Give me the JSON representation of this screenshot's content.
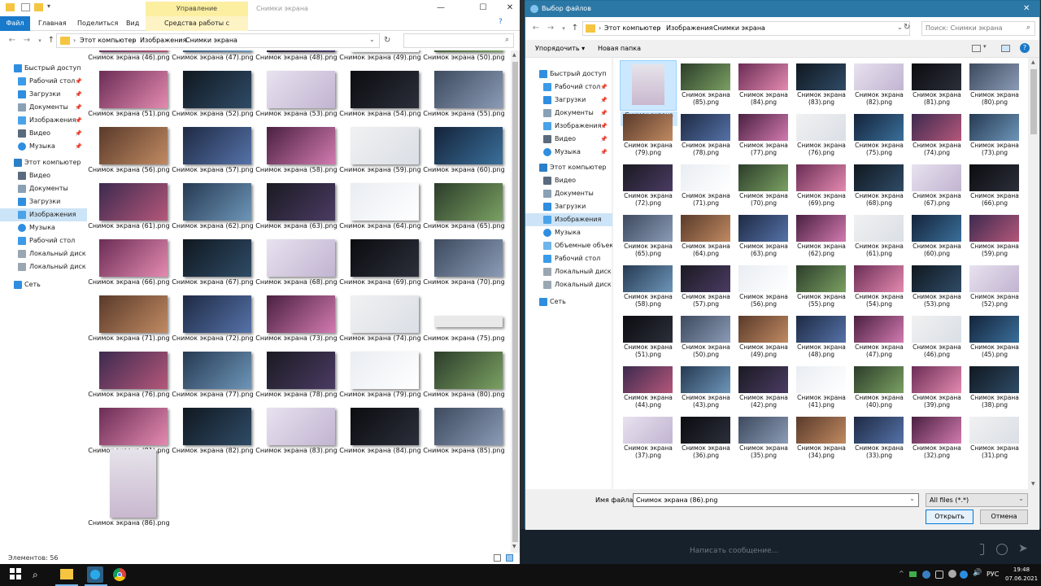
{
  "explorer": {
    "title": "Снимки экрана",
    "tabs": {
      "file": "Файл",
      "home": "Главная",
      "share": "Поделиться",
      "view": "Вид",
      "manage": "Управление",
      "context": "Средства работы с рисунками"
    },
    "breadcrumb": [
      "Этот компьютер",
      "Изображения",
      "Снимки экрана"
    ],
    "sidebar": {
      "quick": "Быстрый доступ",
      "quick_items": [
        "Рабочий стол",
        "Загрузки",
        "Документы",
        "Изображения",
        "Видео",
        "Музыка"
      ],
      "pc": "Этот компьютер",
      "pc_items": [
        "Видео",
        "Документы",
        "Загрузки",
        "Изображения",
        "Музыка",
        "Рабочий стол",
        "Локальный диск (C",
        "Локальный диск (D"
      ],
      "network": "Сеть"
    },
    "files": [
      "Снимок экрана (46).png",
      "Снимок экрана (47).png",
      "Снимок экрана (48).png",
      "Снимок экрана (49).png",
      "Снимок экрана (50).png",
      "Снимок экрана (51).png",
      "Снимок экрана (52).png",
      "Снимок экрана (53).png",
      "Снимок экрана (54).png",
      "Снимок экрана (55).png",
      "Снимок экрана (56).png",
      "Снимок экрана (57).png",
      "Снимок экрана (58).png",
      "Снимок экрана (59).png",
      "Снимок экрана (60).png",
      "Снимок экрана (61).png",
      "Снимок экрана (62).png",
      "Снимок экрана (63).png",
      "Снимок экрана (64).png",
      "Снимок экрана (65).png",
      "Снимок экрана (66).png",
      "Снимок экрана (67).png",
      "Снимок экрана (68).png",
      "Снимок экрана (69).png",
      "Снимок экрана (70).png",
      "Снимок экрана (71).png",
      "Снимок экрана (72).png",
      "Снимок экрана (73).png",
      "Снимок экрана (74).png",
      "Снимок экрана (75).png",
      "Снимок экрана (76).png",
      "Снимок экрана (77).png",
      "Снимок экрана (78).png",
      "Снимок экрана (79).png",
      "Снимок экрана (80).png",
      "Снимок экрана (81).png",
      "Снимок экрана (82).png",
      "Снимок экрана (83).png",
      "Снимок экрана (84).png",
      "Снимок экрана (85).png",
      "Снимок экрана (86).png"
    ],
    "status": "Элементов: 56"
  },
  "dialog": {
    "title": "Выбор файлов",
    "breadcrumb": [
      "Этот компьютер",
      "Изображения",
      "Снимки экрана"
    ],
    "search_placeholder": "Поиск: Снимки экрана",
    "organize": "Упорядочить",
    "new_folder": "Новая папка",
    "sidebar": {
      "quick": "Быстрый доступ",
      "quick_items": [
        "Рабочий стол",
        "Загрузки",
        "Документы",
        "Изображения",
        "Видео",
        "Музыка"
      ],
      "pc": "Этот компьютер",
      "pc_items": [
        "Видео",
        "Документы",
        "Загрузки",
        "Изображения",
        "Музыка",
        "Объемные объекты",
        "Рабочий стол",
        "Локальный диск (C",
        "Локальный диск (D"
      ],
      "network": "Сеть"
    },
    "files": [
      "Снимок экрана (86).png",
      "Снимок экрана (85).png",
      "Снимок экрана (84).png",
      "Снимок экрана (83).png",
      "Снимок экрана (82).png",
      "Снимок экрана (81).png",
      "Снимок экрана (80).png",
      "Снимок экрана (79).png",
      "Снимок экрана (78).png",
      "Снимок экрана (77).png",
      "Снимок экрана (76).png",
      "Снимок экрана (75).png",
      "Снимок экрана (74).png",
      "Снимок экрана (73).png",
      "Снимок экрана (72).png",
      "Снимок экрана (71).png",
      "Снимок экрана (70).png",
      "Снимок экрана (69).png",
      "Снимок экрана (68).png",
      "Снимок экрана (67).png",
      "Снимок экрана (66).png",
      "Снимок экрана (65).png",
      "Снимок экрана (64).png",
      "Снимок экрана (63).png",
      "Снимок экрана (62).png",
      "Снимок экрана (61).png",
      "Снимок экрана (60).png",
      "Снимок экрана (59).png",
      "Снимок экрана (58).png",
      "Снимок экрана (57).png",
      "Снимок экрана (56).png",
      "Снимок экрана (55).png",
      "Снимок экрана (54).png",
      "Снимок экрана (53).png",
      "Снимок экрана (52).png",
      "Снимок экрана (51).png",
      "Снимок экрана (50).png",
      "Снимок экрана (49).png",
      "Снимок экрана (48).png",
      "Снимок экрана (47).png",
      "Снимок экрана (46).png",
      "Снимок экрана (45).png",
      "Снимок экрана (44).png",
      "Снимок экрана (43).png",
      "Снимок экрана (42).png",
      "Снимок экрана (41).png",
      "Снимок экрана (40).png",
      "Снимок экрана (39).png",
      "Снимок экрана (38).png",
      "Снимок экрана (37).png",
      "Снимок экрана (36).png",
      "Снимок экрана (35).png",
      "Снимок экрана (34).png",
      "Снимок экрана (33).png",
      "Снимок экрана (32).png",
      "Снимок экрана (31).png"
    ],
    "filename_label": "Имя файла:",
    "filename_value": "Снимок экрана (86).png",
    "filetype_value": "All files (*.*)",
    "open_button": "Открыть",
    "cancel_button": "Отмена"
  },
  "chat": {
    "input_placeholder": "Написать сообщение..."
  },
  "taskbar": {
    "time": "19:48",
    "date": "07.06.2021",
    "lang": "РУС"
  },
  "colors": {
    "accent": "#1979ca",
    "dialog_title": "#2b78a6",
    "selection": "#cce8ff",
    "ribbon_context": "#fcefa1",
    "taskbar": "#101010"
  }
}
